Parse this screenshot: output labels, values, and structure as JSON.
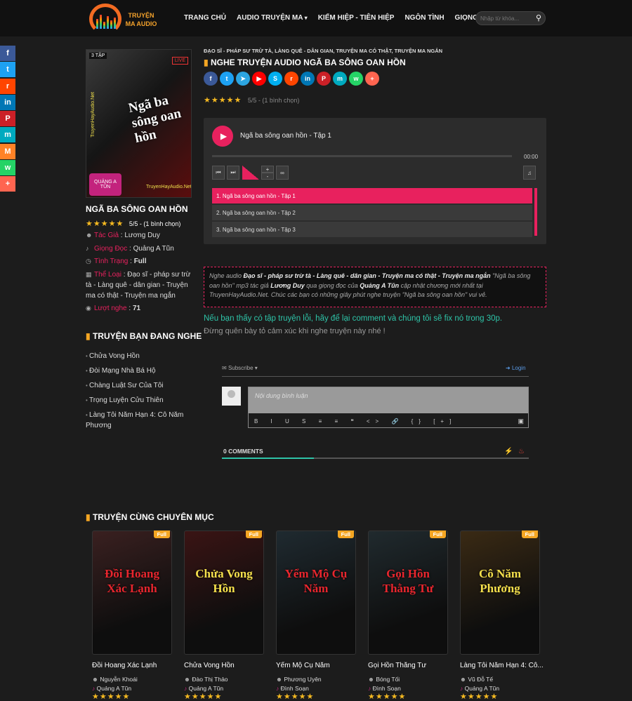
{
  "header": {
    "logo_text": "TRUYỆN MA AUDIO",
    "nav": [
      "TRANG CHỦ",
      "AUDIO TRUYỆN MA",
      "KIẾM HIỆP - TIÊN HIỆP",
      "NGÔN TÌNH",
      "GIỌNG ĐỌC"
    ],
    "search_placeholder": "Nhập từ khóa..."
  },
  "social_side": [
    {
      "icon": "facebook-icon",
      "color": "#3b5998",
      "glyph": "f"
    },
    {
      "icon": "twitter-icon",
      "color": "#1da1f2",
      "glyph": "t"
    },
    {
      "icon": "reddit-icon",
      "color": "#ff4500",
      "glyph": "r"
    },
    {
      "icon": "linkedin-icon",
      "color": "#0077b5",
      "glyph": "in"
    },
    {
      "icon": "pinterest-icon",
      "color": "#cb2027",
      "glyph": "P"
    },
    {
      "icon": "mewe-icon",
      "color": "#00aabf",
      "glyph": "m"
    },
    {
      "icon": "mix-icon",
      "color": "#ff8226",
      "glyph": "M"
    },
    {
      "icon": "whatsapp-icon",
      "color": "#25d366",
      "glyph": "w"
    },
    {
      "icon": "more-icon",
      "color": "#ff6550",
      "glyph": "+"
    }
  ],
  "poster": {
    "badge": "3 TẬP",
    "live": "LIVE",
    "title": "Ngã ba sông oan hồn",
    "site_vertical": "TruyenHayAudio.Net",
    "site_bottom": "TruyenHayAudio.Net",
    "reader": "QUẢNG A TŨN"
  },
  "story": {
    "title": "NGÃ BA SÔNG OAN HỒN",
    "rating_text": "5/5 - (1 bình chọn)",
    "author_label": "Tác Giả",
    "author": "Lương Duy",
    "voice_label": "Giọng Đọc",
    "voice": "Quảng A Tũn",
    "status_label": "Tình Trạng",
    "status": "Full",
    "genre_label": "Thể Loại",
    "genre": "Đạo sĩ - pháp sư trừ tà - Làng quê - dân gian - Truyện ma có thật - Truyện ma ngắn",
    "views_label": "Lượt nghe",
    "views": "71"
  },
  "sidebar": {
    "title": "TRUYỆN BẠN ĐANG NGHE",
    "items": [
      "Chửa Vong Hồn",
      "Đòi Mạng Nhà Bá Hộ",
      "Chàng Luật Sư Của Tôi",
      "Trọng Luyện Cửu Thiên",
      "Làng Tôi Năm Hạn 4: Cô Năm Phương"
    ]
  },
  "main": {
    "breadcrumb": "ĐẠO SĨ - PHÁP SƯ TRỪ TÀ, LÀNG QUÊ - DÂN GIAN, TRUYỆN MA CÓ THẬT, TRUYỆN MA NGẮN",
    "title": "NGHE TRUYỆN AUDIO NGÃ BA SÔNG OAN HỒN",
    "rating_text": "5/5 - (1 bình chọn)",
    "shares": [
      {
        "icon": "facebook-icon",
        "color": "#3b5998",
        "glyph": "f"
      },
      {
        "icon": "twitter-icon",
        "color": "#1da1f2",
        "glyph": "t"
      },
      {
        "icon": "telegram-icon",
        "color": "#2ca5e0",
        "glyph": "➤"
      },
      {
        "icon": "youtube-icon",
        "color": "#ff0000",
        "glyph": "▶"
      },
      {
        "icon": "skype-icon",
        "color": "#00aff0",
        "glyph": "S"
      },
      {
        "icon": "reddit-icon",
        "color": "#ff4500",
        "glyph": "r"
      },
      {
        "icon": "linkedin-icon",
        "color": "#0077b5",
        "glyph": "in"
      },
      {
        "icon": "pinterest-icon",
        "color": "#cb2027",
        "glyph": "P"
      },
      {
        "icon": "mewe-icon",
        "color": "#00aabf",
        "glyph": "m"
      },
      {
        "icon": "whatsapp-icon",
        "color": "#25d366",
        "glyph": "w"
      },
      {
        "icon": "more-icon",
        "color": "#ff6550",
        "glyph": "+"
      }
    ]
  },
  "player": {
    "current_title": "Ngã ba sông oan hồn - Tập 1",
    "time": "00:00",
    "progress": 0,
    "playlist": [
      "1. Ngã ba sông oan hồn - Tập 1",
      "2. Ngã ba sông oan hồn - Tập 2",
      "3. Ngã ba sông oan hồn - Tập 3"
    ]
  },
  "description": {
    "p1": "Nghe audio ",
    "genre": "Đạo sĩ - pháp sư trừ tà - Làng quê - dân gian - Truyện ma có thật - Truyện ma ngắn",
    "p2": " \"Ngã ba sông oan hồn\" mp3 tác giả ",
    "author": "Lương Duy",
    "p3": " qua giọng đọc của ",
    "voice": "Quảng A Tũn",
    "p4": " cập nhật chương mới nhất tại TruyenHayAudio.Net. Chúc các bạn có những giây phút nghe truyện \"Ngã ba sông oan hồn\" vui vẻ."
  },
  "notice": {
    "line1": "Nếu bạn thấy có tập truyện lỗi, hãy để lại comment và chúng tôi sẽ fix nó trong 30p.",
    "line2": "Đừng quên bày tỏ cảm xúc khi nghe truyện này nhé !"
  },
  "comments": {
    "subscribe": "Subscribe",
    "login": "Login",
    "placeholder": "Nội dung bình luận",
    "toolbar": "B I U S ≡ ≡ ❝ <> 🔗 {} [+]",
    "count": "0 COMMENTS"
  },
  "related": {
    "title": "TRUYỆN CÙNG CHUYÊN MỤC",
    "badge": "Full",
    "cards": [
      {
        "name": "Đồi Hoang Xác Lạnh",
        "author": "Nguyễn Khoái",
        "reader": "Quảng A Tũn",
        "cover_title": "Đồi Hoang Xác Lạnh",
        "bg": "#3a2020",
        "fg": "#e8262e"
      },
      {
        "name": "Chửa Vong Hồn",
        "author": "Đào Thị Thảo",
        "reader": "Quảng A Tũn",
        "cover_title": "Chửa Vong Hồn",
        "bg": "#3a1414",
        "fg": "#f5e04c"
      },
      {
        "name": "Yểm Mộ Cụ Năm",
        "author": "Phương Uyên",
        "reader": "Đình Soạn",
        "cover_title": "Yểm Mộ Cụ Năm",
        "bg": "#1f2a30",
        "fg": "#e8262e"
      },
      {
        "name": "Gọi Hồn Thằng Tư",
        "author": "Bóng Tối",
        "reader": "Đình Soạn",
        "cover_title": "Gọi Hồn Thằng Tư",
        "bg": "#202a2e",
        "fg": "#e8262e"
      },
      {
        "name": "Làng Tôi Năm Hạn 4: Cô...",
        "author": "Vũ Đỗ Tế",
        "reader": "Quảng A Tũn",
        "cover_title": "Cô Năm Phương",
        "bg": "#3a2a14",
        "fg": "#f5e04c"
      }
    ]
  }
}
